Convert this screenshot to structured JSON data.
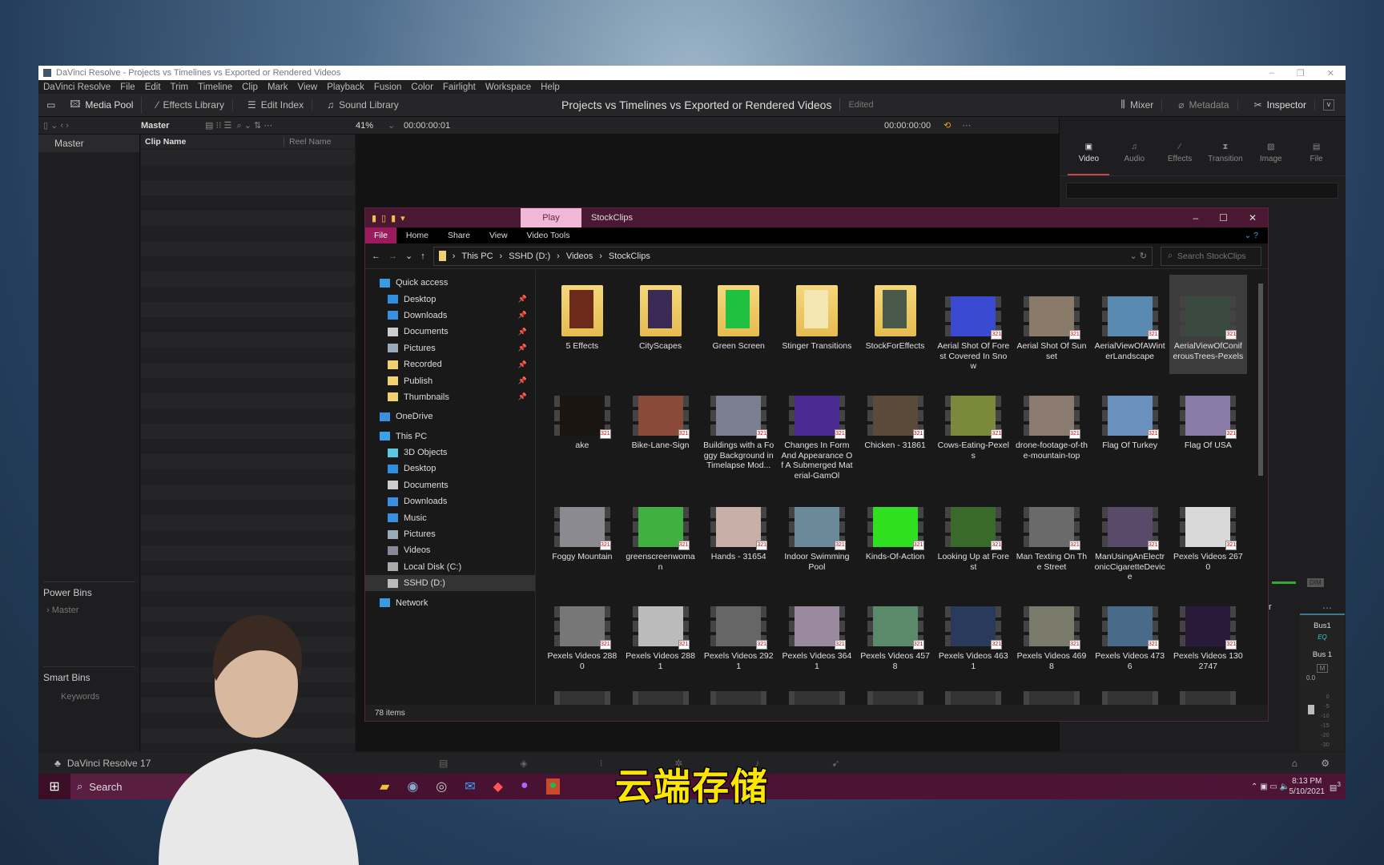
{
  "resolve": {
    "window_title": "DaVinci Resolve - Projects vs Timelines vs Exported or Rendered Videos",
    "menu": [
      "DaVinci Resolve",
      "File",
      "Edit",
      "Trim",
      "Timeline",
      "Clip",
      "Mark",
      "View",
      "Playback",
      "Fusion",
      "Color",
      "Fairlight",
      "Workspace",
      "Help"
    ],
    "toolbar": {
      "media_pool": "Media Pool",
      "effects_library": "Effects Library",
      "edit_index": "Edit Index",
      "sound_library": "Sound Library",
      "mixer": "Mixer",
      "metadata": "Metadata",
      "inspector": "Inspector"
    },
    "project_title": "Projects vs Timelines vs Exported or Rendered Videos",
    "project_status": "Edited",
    "bin_header": "Master",
    "zoom": "41%",
    "source_timecode": "00:00:00:01",
    "timeline_timecode": "00:00:00:00",
    "columns": {
      "clip_name": "Clip Name",
      "reel_name": "Reel Name"
    },
    "bins": {
      "master": "Master",
      "power_bins": "Power Bins",
      "power_master": "Master",
      "smart_bins": "Smart Bins",
      "keywords": "Keywords"
    },
    "inspector_tabs": [
      "Video",
      "Audio",
      "Effects",
      "Transition",
      "Image",
      "File"
    ],
    "mixer": {
      "title": "ixer",
      "dim": "DIM",
      "bus_name": "Bus1",
      "eq": "EQ",
      "bus_label": "Bus 1",
      "mute": "M",
      "level": "0.0",
      "scale": [
        "0",
        "-5",
        "-10",
        "-15",
        "-20",
        "-30",
        "-40",
        "-50"
      ]
    },
    "app_version": "DaVinci Resolve 17",
    "accent": "#c7484d"
  },
  "explorer": {
    "title": "StockClips",
    "play_tab": "Play",
    "ribbon": [
      "File",
      "Home",
      "Share",
      "View",
      "Video Tools"
    ],
    "breadcrumb": [
      "This PC",
      "SSHD (D:)",
      "Videos",
      "StockClips"
    ],
    "search_placeholder": "Search StockClips",
    "nav": [
      {
        "label": "Quick access",
        "level": 1,
        "icon": "star-icon",
        "color": "#3a9be0"
      },
      {
        "label": "Desktop",
        "level": 2,
        "icon": "desktop-icon",
        "pinned": true,
        "color": "#2e8fe0"
      },
      {
        "label": "Downloads",
        "level": 2,
        "icon": "download-icon",
        "pinned": true,
        "color": "#3a8fe0"
      },
      {
        "label": "Documents",
        "level": 2,
        "icon": "document-icon",
        "pinned": true,
        "color": "#ccc"
      },
      {
        "label": "Pictures",
        "level": 2,
        "icon": "pictures-icon",
        "pinned": true,
        "color": "#9ab"
      },
      {
        "label": "Recorded",
        "level": 2,
        "icon": "folder-icon",
        "pinned": true,
        "color": "#f0d070"
      },
      {
        "label": "Publish",
        "level": 2,
        "icon": "folder-icon",
        "pinned": true,
        "color": "#f0d070"
      },
      {
        "label": "Thumbnails",
        "level": 2,
        "icon": "folder-icon",
        "pinned": true,
        "color": "#f0d070"
      },
      {
        "label": "",
        "level": 0
      },
      {
        "label": "OneDrive",
        "level": 1,
        "icon": "cloud-icon",
        "color": "#3a8fe0"
      },
      {
        "label": "",
        "level": 0
      },
      {
        "label": "This PC",
        "level": 1,
        "icon": "computer-icon",
        "color": "#3aa0e8"
      },
      {
        "label": "3D Objects",
        "level": 2,
        "icon": "cube-icon",
        "color": "#5cc8e0"
      },
      {
        "label": "Desktop",
        "level": 2,
        "icon": "desktop-icon",
        "color": "#2e8fe0"
      },
      {
        "label": "Documents",
        "level": 2,
        "icon": "document-icon",
        "color": "#ccc"
      },
      {
        "label": "Downloads",
        "level": 2,
        "icon": "download-icon",
        "color": "#3a8fe0"
      },
      {
        "label": "Music",
        "level": 2,
        "icon": "music-icon",
        "color": "#3a8fe0"
      },
      {
        "label": "Pictures",
        "level": 2,
        "icon": "pictures-icon",
        "color": "#9ab"
      },
      {
        "label": "Videos",
        "level": 2,
        "icon": "video-icon",
        "color": "#889"
      },
      {
        "label": "Local Disk (C:)",
        "level": 2,
        "icon": "drive-icon",
        "color": "#aaa"
      },
      {
        "label": "SSHD (D:)",
        "level": 2,
        "icon": "drive-icon",
        "color": "#bbb",
        "selected": true
      },
      {
        "label": "",
        "level": 0
      },
      {
        "label": "Network",
        "level": 1,
        "icon": "network-icon",
        "color": "#3a9be0"
      }
    ],
    "items": [
      {
        "name": "5 Effects",
        "type": "folder",
        "color": "#6b2a1a"
      },
      {
        "name": "CityScapes",
        "type": "folder",
        "color": "#3a2a55"
      },
      {
        "name": "Green Screen",
        "type": "folder",
        "color": "#20c040"
      },
      {
        "name": "Stinger Transitions",
        "type": "folder",
        "color": "#f4e6b0"
      },
      {
        "name": "StockForEffects",
        "type": "folder",
        "color": "#4a5a4a"
      },
      {
        "name": "Aerial Shot Of Forest Covered In Snow",
        "type": "video",
        "color": "#3a4ad0"
      },
      {
        "name": "Aerial Shot Of Sunset",
        "type": "video",
        "color": "#8a7a6a"
      },
      {
        "name": "AerialViewOfAWinterLandscape",
        "type": "video",
        "color": "#5a8ab0"
      },
      {
        "name": "AerialViewOfConiferousTrees-Pexels",
        "type": "video",
        "color": "#3a4a40",
        "selected": true
      },
      {
        "name": "ake",
        "type": "video",
        "color": "#1a1510"
      },
      {
        "name": "Bike-Lane-Sign",
        "type": "video",
        "color": "#8a4a3a"
      },
      {
        "name": "Buildings with a Foggy Background in Timelapse Mod...",
        "type": "video",
        "color": "#7a8090"
      },
      {
        "name": "Changes In Form And Appearance Of A Submerged Material-GamOl",
        "type": "video",
        "color": "#4a2a90"
      },
      {
        "name": "Chicken - 31861",
        "type": "video",
        "color": "#5a4a3a"
      },
      {
        "name": "Cows-Eating-Pexels",
        "type": "video",
        "color": "#7a8a3a"
      },
      {
        "name": "drone-footage-of-the-mountain-top",
        "type": "video",
        "color": "#8a7a70"
      },
      {
        "name": "Flag Of Turkey",
        "type": "video",
        "color": "#6a90c0"
      },
      {
        "name": "Flag Of USA",
        "type": "video",
        "color": "#8a7aa8"
      },
      {
        "name": "Foggy Mountain",
        "type": "video",
        "color": "#8a8a90"
      },
      {
        "name": "greenscreenwoman",
        "type": "video",
        "color": "#40b040"
      },
      {
        "name": "Hands - 31654",
        "type": "video",
        "color": "#c8b0a8"
      },
      {
        "name": "Indoor Swimming Pool",
        "type": "video",
        "color": "#6a8a9a"
      },
      {
        "name": "Kinds-Of-Action",
        "type": "video",
        "color": "#2ee020"
      },
      {
        "name": "Looking Up at Forest",
        "type": "video",
        "color": "#3a6a2a"
      },
      {
        "name": "Man Texting On The Street",
        "type": "video",
        "color": "#6a6a6a"
      },
      {
        "name": "ManUsingAnElectronicCigaretteDevice",
        "type": "video",
        "color": "#5a4a6a"
      },
      {
        "name": "Pexels Videos 2670",
        "type": "video",
        "color": "#d8d8d8"
      },
      {
        "name": "Pexels Videos 2880",
        "type": "video",
        "color": "#777"
      },
      {
        "name": "Pexels Videos 2881",
        "type": "video",
        "color": "#bbb"
      },
      {
        "name": "Pexels Videos 2921",
        "type": "video",
        "color": "#666"
      },
      {
        "name": "Pexels Videos 3641",
        "type": "video",
        "color": "#9a8aa0"
      },
      {
        "name": "Pexels Videos 4578",
        "type": "video",
        "color": "#5a8a6a"
      },
      {
        "name": "Pexels Videos 4631",
        "type": "video",
        "color": "#2a3a5a"
      },
      {
        "name": "Pexels Videos 4698",
        "type": "video",
        "color": "#7a7a6a"
      },
      {
        "name": "Pexels Videos 4736",
        "type": "video",
        "color": "#4a6a8a"
      },
      {
        "name": "Pexels Videos 1302747",
        "type": "video",
        "color": "#2a1a3a"
      }
    ],
    "status": "78 items"
  },
  "taskbar": {
    "search": "Search",
    "time": "8:13 PM",
    "date": "5/10/2021",
    "notifications": "3"
  },
  "subtitle": "云端存储"
}
